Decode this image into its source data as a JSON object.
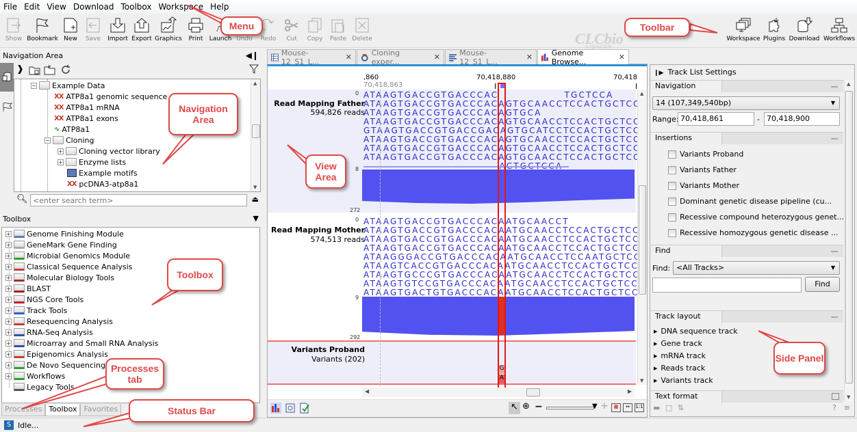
{
  "menu": [
    "File",
    "Edit",
    "View",
    "Download",
    "Toolbox",
    "Workspace",
    "Help"
  ],
  "toolbar": {
    "left": [
      {
        "label": "Show",
        "icon": "show-icon",
        "enabled": false
      },
      {
        "label": "Bookmark",
        "icon": "bookmark-flag-icon",
        "enabled": true
      },
      {
        "label": "New",
        "icon": "new-icon",
        "enabled": true
      },
      {
        "label": "Save",
        "icon": "save-icon",
        "enabled": false
      },
      {
        "label": "Import",
        "icon": "import-icon",
        "enabled": true
      },
      {
        "label": "Export",
        "icon": "export-icon",
        "enabled": true
      },
      {
        "label": "Graphics",
        "icon": "graphics-icon",
        "enabled": true
      },
      {
        "label": "Print",
        "icon": "print-icon",
        "enabled": true
      },
      {
        "label": "Launch",
        "icon": "launch-icon",
        "enabled": true
      },
      {
        "label": "Undo",
        "icon": "undo-icon",
        "enabled": false
      },
      {
        "label": "Redo",
        "icon": "redo-icon",
        "enabled": false
      },
      {
        "label": "Cut",
        "icon": "cut-icon",
        "enabled": false
      },
      {
        "label": "Copy",
        "icon": "copy-icon",
        "enabled": false
      },
      {
        "label": "Paste",
        "icon": "paste-icon",
        "enabled": false
      },
      {
        "label": "Delete",
        "icon": "delete-icon",
        "enabled": false
      }
    ],
    "right": [
      {
        "label": "Workspace",
        "icon": "workspace-icon"
      },
      {
        "label": "Plugins",
        "icon": "plugins-icon"
      },
      {
        "label": "Download",
        "icon": "download-icon"
      },
      {
        "label": "Workflows",
        "icon": "workflows-icon"
      }
    ],
    "logo": "CLCbio",
    "logo_sub": "A QIAGEN"
  },
  "navigation": {
    "title": "Navigation Area",
    "search_placeholder": "<enter search term>",
    "tree": [
      {
        "label": "Example Data",
        "type": "folder",
        "level": 0,
        "expanded": true
      },
      {
        "label": "ATP8a1 genomic sequence",
        "type": "sequence",
        "level": 1
      },
      {
        "label": "ATP8a1 mRNA",
        "type": "sequence",
        "level": 1
      },
      {
        "label": "ATP8a1 exons",
        "type": "sequence",
        "level": 1
      },
      {
        "label": "ATP8a1",
        "type": "protein",
        "level": 1
      },
      {
        "label": "Cloning",
        "type": "folder",
        "level": 1,
        "expanded": true
      },
      {
        "label": "Cloning vector library",
        "type": "folder",
        "level": 2,
        "expanded": false
      },
      {
        "label": "Enzyme lists",
        "type": "folder",
        "level": 2,
        "expanded": false
      },
      {
        "label": "Example motifs",
        "type": "motif",
        "level": 2
      },
      {
        "label": "pcDNA3-atp8a1",
        "type": "sequence",
        "level": 2
      }
    ]
  },
  "toolbox": {
    "title": "Toolbox",
    "items": [
      "Genome Finishing Module",
      "GeneMark Gene Finding",
      "Microbial Genomics Module",
      "Classical Sequence Analysis",
      "Molecular Biology Tools",
      "BLAST",
      "NGS Core Tools",
      "Track Tools",
      "Resequencing Analysis",
      "RNA-Seq Analysis",
      "Microarray and Small RNA Analysis",
      "Epigenomics Analysis",
      "De Novo Sequencing",
      "Workflows",
      "Legacy Tools"
    ],
    "tabs": [
      {
        "label": "Processes",
        "active": false
      },
      {
        "label": "Toolbox",
        "active": true
      },
      {
        "label": "Favorites",
        "active": false
      }
    ]
  },
  "status": {
    "icon_letter": "S",
    "text": "Idle..."
  },
  "editor_tabs": [
    {
      "label": "Mouse-12_S1_L...",
      "icon": "table-icon",
      "active": false
    },
    {
      "label": "Cloning exper...",
      "icon": "cloning-icon",
      "active": false
    },
    {
      "label": "Mouse-12_S1_L...",
      "icon": "list-icon",
      "active": false
    },
    {
      "label": "Genome Browse...",
      "icon": "genome-browser-icon",
      "active": true
    }
  ],
  "view": {
    "ruler": {
      "left": ",860",
      "left_sub": "70,418,863",
      "center": "70,418,880",
      "right": "70,418"
    },
    "father": {
      "name": "Read Mapping Father",
      "reads": "594,826 reads",
      "top_tick": "0",
      "mid_tick": "8",
      "bottom_tick": "272",
      "rows": [
        "ATAAGTGACCGTGACCCAC                TGCTCCA",
        "ATAAGTGACCGTGACCCACAGTGCAACCTCCACTGCTCCA",
        "ATAAGTGACCGTGACCCACAGTGCA",
        "ATAAGTGACCGTGACCCACAGTGCAACCTCCACTGCTCCA",
        "GTAAGTGACCGTGACCGACAGTGCATCCTCCACTGCTCCA",
        "ATAAGTGACCGTGACCCACAGTGCAACCTCCACTGCTCCA",
        "ATAAGTGACCGTGACCCACAGTGCAACCTCCACTGCTCCA",
        "ATAAGTGACCGTGACCCACAGTGCAACCTCCACTGCTCCA",
        "                                 ACTGCTCCA"
      ]
    },
    "mother": {
      "name": "Read Mapping Mother",
      "reads": "574,513 reads",
      "top_tick": "0",
      "mid_tick": "9",
      "bottom_tick": "292",
      "rows": [
        "ATAAGTGACCGTGACCCACAATGCAACCT",
        "ATAAGTGACCGTGACCCACAATGCAACCTCCACTGCTCCA",
        "ATAAGTGACCGTGACCCACAATGCAACCTCCACTGCTCCA",
        "ATAAGTGACCGTGACCCACAATGCAACCTCCACTGCTCCA",
        "ATAAGGGACCGTGACCCACAATGCAACCTCCAATGCTCCA",
        "ATAAGTCACCGTGACCCACAATGCAACCTCCACTGCTCCA",
        "ATAAGTGCCCGTGACCCACAATGCAACCTCCACTGCTCCA",
        "ATAAGTGTCCGTGACCCACAATGCAACCTCCACTGCTCCA",
        "ATAAGTGACTGTGACCCACAATGCAACCTCCACTGCTCCA"
      ]
    },
    "variants": {
      "name": "Variants Proband",
      "count": "Variants (202)",
      "alleles": [
        "G",
        "A"
      ]
    }
  },
  "side_panel": {
    "title": "Track List Settings",
    "navigation": {
      "title": "Navigation",
      "chromosome": "14 (107,349,540bp)",
      "range_label": "Range:",
      "range_from": "70,418,861",
      "range_sep": "-",
      "range_to": "70,418,900"
    },
    "insertions": {
      "title": "Insertions",
      "items": [
        {
          "label": "Variants Proband",
          "checked": false
        },
        {
          "label": "Variants Father",
          "checked": false
        },
        {
          "label": "Variants Mother",
          "checked": false
        },
        {
          "label": "Dominant genetic disease pipeline (cu...",
          "checked": false
        },
        {
          "label": "Recessive compound heterozygous genet...",
          "checked": false
        },
        {
          "label": "Recessive homozygous genetic disease ...",
          "checked": false
        }
      ]
    },
    "find": {
      "title": "Find",
      "label": "Find:",
      "scope": "<All Tracks>",
      "value": "",
      "button": "Find"
    },
    "track_layout": {
      "title": "Track layout",
      "items": [
        "DNA sequence track",
        "Gene track",
        "mRNA track",
        "Reads track",
        "Variants track"
      ]
    },
    "text_format": {
      "title": "Text format"
    }
  },
  "callouts": {
    "menu": "Menu",
    "toolbar": "Toolbar",
    "navigation": "Navigation Area",
    "view": "View Area",
    "toolbox": "Toolbox",
    "processes": "Processes tab",
    "status": "Status Bar",
    "side": "Side Panel"
  },
  "colors": {
    "accent": "#2d8ed8",
    "coverage": "#5252f0",
    "sequence": "#2b2bcc",
    "callout": "#e04848",
    "selection": "#e01818"
  }
}
